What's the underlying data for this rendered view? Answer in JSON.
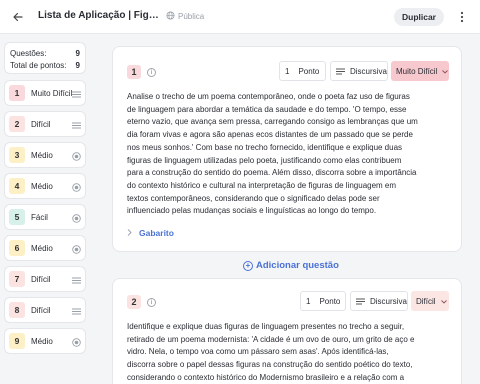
{
  "header": {
    "title": "Lista de Aplicação | Figuras de Linguagem",
    "visibility_label": "Pública",
    "duplicate_label": "Duplicar"
  },
  "summary": {
    "questions_label": "Questões:",
    "questions_value": "9",
    "points_label": "Total de pontos:",
    "points_value": "9"
  },
  "sidebar_items": [
    {
      "number": "1",
      "difficulty": "Muito Difícil",
      "badge_color": "#f9d9dc",
      "type_icon": "lines-icon"
    },
    {
      "number": "2",
      "difficulty": "Difícil",
      "badge_color": "#fbe3e2",
      "type_icon": "lines-icon"
    },
    {
      "number": "3",
      "difficulty": "Médio",
      "badge_color": "#fdf0c6",
      "type_icon": "radio-icon"
    },
    {
      "number": "4",
      "difficulty": "Médio",
      "badge_color": "#fdf0c6",
      "type_icon": "radio-icon"
    },
    {
      "number": "5",
      "difficulty": "Fácil",
      "badge_color": "#d7f0ea",
      "type_icon": "radio-icon"
    },
    {
      "number": "6",
      "difficulty": "Médio",
      "badge_color": "#fdf0c6",
      "type_icon": "radio-icon"
    },
    {
      "number": "7",
      "difficulty": "Difícil",
      "badge_color": "#fbe3e2",
      "type_icon": "lines-icon"
    },
    {
      "number": "8",
      "difficulty": "Difícil",
      "badge_color": "#fbe3e2",
      "type_icon": "lines-icon"
    },
    {
      "number": "9",
      "difficulty": "Médio",
      "badge_color": "#fdf0c6",
      "type_icon": "radio-icon"
    }
  ],
  "questions": [
    {
      "number": "1",
      "badge_color": "#f9d9dc",
      "points_value": "1",
      "points_label": "Ponto",
      "type_label": "Discursiva",
      "difficulty_label": "Muito Difícil",
      "difficulty_bg": "#f7c8cd",
      "text": "Analise o trecho de um poema contemporâneo, onde o poeta faz uso de figuras de linguagem para abordar a temática da saudade e do tempo. 'O tempo, esse eterno vazio, que avança sem pressa, carregando consigo as lembranças que um dia foram vivas e agora são apenas ecos distantes de um passado que se perde nos meus sonhos.' Com base no trecho fornecido, identifique e explique duas figuras de linguagem utilizadas pelo poeta, justificando como elas contribuem para a construção do sentido do poema. Além disso, discorra sobre a importância do contexto histórico e cultural na interpretação de figuras de linguagem em textos contemporâneos, considerando que o significado delas pode ser influenciado pelas mudanças sociais e linguísticas ao longo do tempo.",
      "answer_label": "Gabarito"
    },
    {
      "number": "2",
      "badge_color": "#fbe3e2",
      "points_value": "1",
      "points_label": "Ponto",
      "type_label": "Discursiva",
      "difficulty_label": "Difícil",
      "difficulty_bg": "#fbe6e4",
      "text": "Identifique e explique duas figuras de linguagem presentes no trecho a seguir, retirado de um poema modernista: 'A cidade é um ovo de ouro, um grito de aço e vidro. Nela, o tempo voa como um pássaro sem asas'. Após identificá-las, discorra sobre o papel dessas figuras na construção do sentido poético do texto, considerando o contexto histórico do Modernismo brasileiro e a relação com a visão"
    }
  ],
  "add_question_label": "Adicionar questão"
}
